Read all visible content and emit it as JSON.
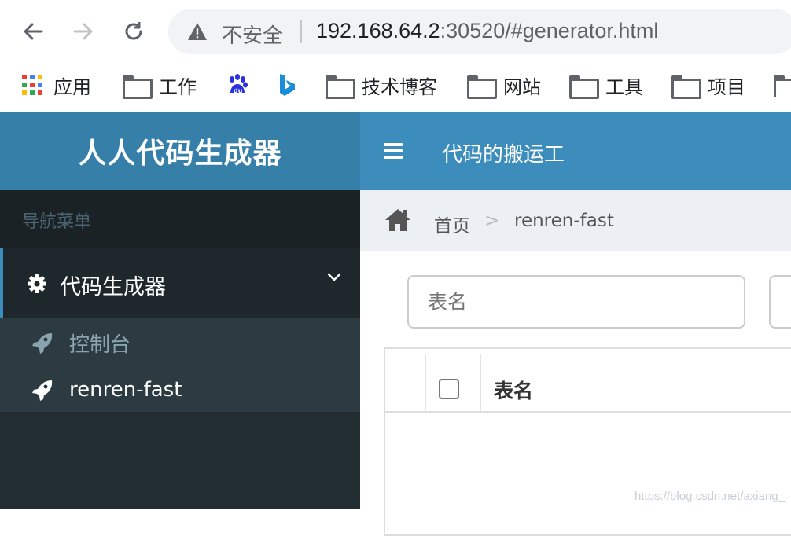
{
  "browser": {
    "security_label": "不安全",
    "url_host": "192.168.64.2",
    "url_rest": ":30520/#generator.html",
    "bookmarks": [
      {
        "label": "应用",
        "icon": "apps-grid-icon"
      },
      {
        "label": "工作",
        "icon": "folder-icon"
      },
      {
        "label": "",
        "icon": "baidu-icon"
      },
      {
        "label": "",
        "icon": "bing-icon"
      },
      {
        "label": "技术博客",
        "icon": "folder-icon"
      },
      {
        "label": "网站",
        "icon": "folder-icon"
      },
      {
        "label": "工具",
        "icon": "folder-icon"
      },
      {
        "label": "项目",
        "icon": "folder-icon"
      }
    ]
  },
  "app": {
    "logo": "人人代码生成器",
    "topbar_title": "代码的搬运工"
  },
  "sidebar": {
    "header": "导航菜单",
    "menu": {
      "label": "代码生成器",
      "icon": "gear-icon",
      "items": [
        {
          "label": "控制台",
          "icon": "rocket-icon"
        },
        {
          "label": "renren-fast",
          "icon": "rocket-icon"
        }
      ]
    }
  },
  "breadcrumb": {
    "home": "首页",
    "separator": ">",
    "current": "renren-fast"
  },
  "main": {
    "search_placeholder": "表名",
    "table": {
      "columns": [
        "表名"
      ]
    }
  },
  "watermark": "https://blog.csdn.net/axiang_",
  "colors": {
    "logo_bg": "#367fa9",
    "topbar_bg": "#3c8dbc",
    "sidebar_bg": "#222d32",
    "submenu_bg": "#2c3b41",
    "content_bg": "#ecf0f5"
  }
}
